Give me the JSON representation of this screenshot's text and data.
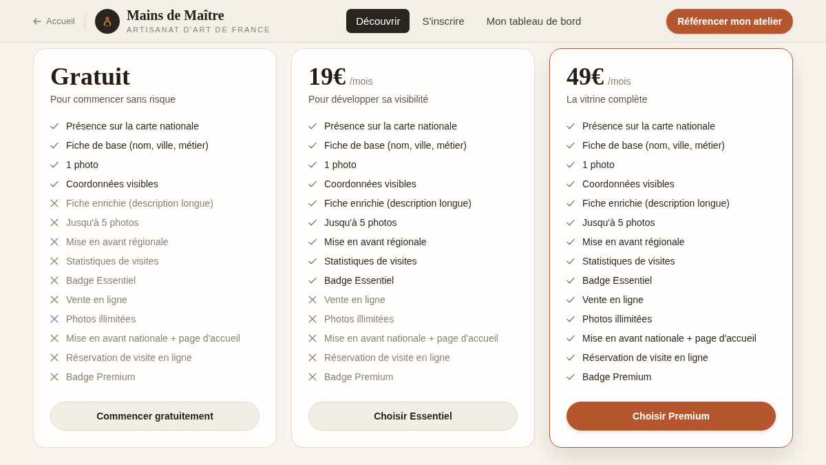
{
  "header": {
    "back_link": "Accueil",
    "brand": {
      "name": "Mains de Maître",
      "tagline": "ARTISANAT D'ART DE FRANCE"
    },
    "nav": [
      {
        "label": "Découvrir",
        "selected": true
      },
      {
        "label": "S'inscrire",
        "selected": false
      },
      {
        "label": "Mon tableau de bord",
        "selected": false
      }
    ],
    "cta": "Référencer mon atelier"
  },
  "plans": [
    {
      "price": "Gratuit",
      "subtitle": "Pour commencer sans risque",
      "featured": false,
      "features": [
        {
          "label": "Présence sur la carte nationale",
          "included": true
        },
        {
          "label": "Fiche de base (nom, ville, métier)",
          "included": true
        },
        {
          "label": "1 photo",
          "included": true
        },
        {
          "label": "Coordonnées visibles",
          "included": true
        },
        {
          "label": "Fiche enrichie (description longue)",
          "included": false
        },
        {
          "label": "Jusqu'à 5 photos",
          "included": false
        },
        {
          "label": "Mise en avant régionale",
          "included": false
        },
        {
          "label": "Statistiques de visites",
          "included": false
        },
        {
          "label": "Badge Essentiel",
          "included": false
        },
        {
          "label": "Vente en ligne",
          "included": false
        },
        {
          "label": "Photos illimitées",
          "included": false
        },
        {
          "label": "Mise en avant nationale + page d'accueil",
          "included": false
        },
        {
          "label": "Réservation de visite en ligne",
          "included": false
        },
        {
          "label": "Badge Premium",
          "included": false
        }
      ],
      "button": "Commencer gratuitement"
    },
    {
      "price": "19€",
      "period": "/mois",
      "subtitle": "Pour développer sa visibilité",
      "featured": false,
      "features": [
        {
          "label": "Présence sur la carte nationale",
          "included": true
        },
        {
          "label": "Fiche de base (nom, ville, métier)",
          "included": true
        },
        {
          "label": "1 photo",
          "included": true
        },
        {
          "label": "Coordonnées visibles",
          "included": true
        },
        {
          "label": "Fiche enrichie (description longue)",
          "included": true
        },
        {
          "label": "Jusqu'à 5 photos",
          "included": true
        },
        {
          "label": "Mise en avant régionale",
          "included": true
        },
        {
          "label": "Statistiques de visites",
          "included": true
        },
        {
          "label": "Badge Essentiel",
          "included": true
        },
        {
          "label": "Vente en ligne",
          "included": false
        },
        {
          "label": "Photos illimitées",
          "included": false
        },
        {
          "label": "Mise en avant nationale + page d'accueil",
          "included": false
        },
        {
          "label": "Réservation de visite en ligne",
          "included": false
        },
        {
          "label": "Badge Premium",
          "included": false
        }
      ],
      "button": "Choisir Essentiel"
    },
    {
      "price": "49€",
      "period": "/mois",
      "subtitle": "La vitrine complète",
      "featured": true,
      "features": [
        {
          "label": "Présence sur la carte nationale",
          "included": true
        },
        {
          "label": "Fiche de base (nom, ville, métier)",
          "included": true
        },
        {
          "label": "1 photo",
          "included": true
        },
        {
          "label": "Coordonnées visibles",
          "included": true
        },
        {
          "label": "Fiche enrichie (description longue)",
          "included": true
        },
        {
          "label": "Jusqu'à 5 photos",
          "included": true
        },
        {
          "label": "Mise en avant régionale",
          "included": true
        },
        {
          "label": "Statistiques de visites",
          "included": true
        },
        {
          "label": "Badge Essentiel",
          "included": true
        },
        {
          "label": "Vente en ligne",
          "included": true
        },
        {
          "label": "Photos illimitées",
          "included": true
        },
        {
          "label": "Mise en avant nationale + page d'accueil",
          "included": true
        },
        {
          "label": "Réservation de visite en ligne",
          "included": true
        },
        {
          "label": "Badge Premium",
          "included": true
        }
      ],
      "button": "Choisir Premium"
    }
  ]
}
